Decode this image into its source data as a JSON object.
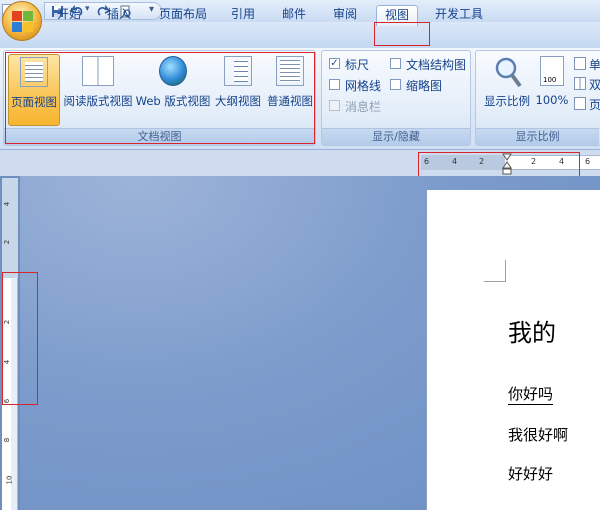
{
  "tabs": {
    "home": "开始",
    "insert": "插入",
    "page_layout": "页面布局",
    "references": "引用",
    "mailings": "邮件",
    "review": "审阅",
    "view": "视图",
    "developer": "开发工具"
  },
  "qat": {
    "dropdown_glyph": "▾",
    "icons": [
      "save-icon",
      "undo-icon",
      "redo-icon",
      "print-preview-icon"
    ]
  },
  "ribbon": {
    "doc_views": {
      "label": "文档视图",
      "buttons": [
        "页面视图",
        "阅读版式视图",
        "Web 版式视图",
        "大纲视图",
        "普通视图"
      ],
      "active": "页面视图"
    },
    "show_hide": {
      "label": "显示/隐藏",
      "items": [
        {
          "text": "标尺",
          "checked": true,
          "enabled": true
        },
        {
          "text": "网格线",
          "checked": false,
          "enabled": true
        },
        {
          "text": "消息栏",
          "checked": false,
          "enabled": false
        },
        {
          "text": "文档结构图",
          "checked": false,
          "enabled": true
        },
        {
          "text": "缩略图",
          "checked": false,
          "enabled": true
        }
      ],
      "check_glyph": "✓"
    },
    "zoom": {
      "label": "显示比例",
      "zoom_button": "显示比例",
      "percent_button": "100%",
      "percent_icon_text": "100",
      "side_buttons": [
        "单",
        "双",
        "页"
      ]
    }
  },
  "ruler": {
    "h_ticks": [
      "6",
      "4",
      "2",
      "2",
      "4",
      "6"
    ],
    "v_ticks": [
      "4",
      "2",
      "2",
      "4",
      "6",
      "8",
      "10"
    ]
  },
  "document": {
    "heading": "我的",
    "lines": [
      "你好吗",
      "我很好啊",
      "好好好"
    ]
  },
  "colors": {
    "accent_red": "#d9242b",
    "ribbon_text": "#15428b",
    "active_button": "#f9c65a"
  }
}
